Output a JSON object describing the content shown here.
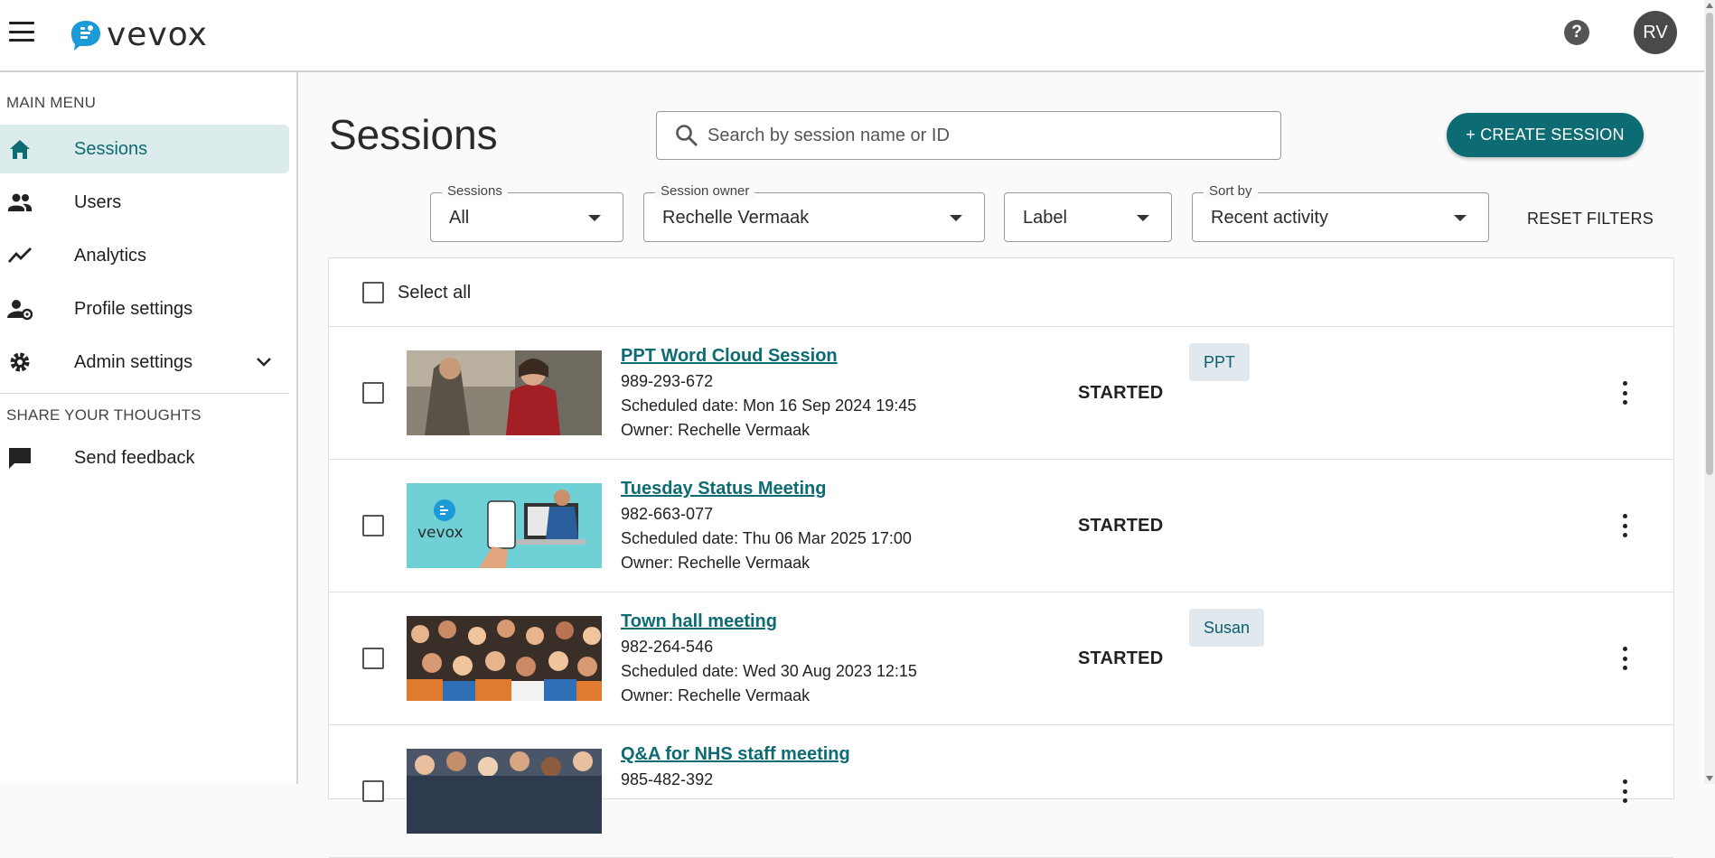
{
  "app": {
    "logo_text": "vevox",
    "avatar_initials": "RV",
    "help_glyph": "?"
  },
  "sidebar": {
    "main_menu_label": "MAIN MENU",
    "items": [
      {
        "label": "Sessions",
        "icon": "home-icon",
        "active": true
      },
      {
        "label": "Users",
        "icon": "users-icon"
      },
      {
        "label": "Analytics",
        "icon": "analytics-icon"
      },
      {
        "label": "Profile settings",
        "icon": "profile-settings-icon"
      },
      {
        "label": "Admin settings",
        "icon": "gear-icon",
        "expandable": true
      }
    ],
    "share_label": "SHARE YOUR THOUGHTS",
    "feedback_label": "Send feedback"
  },
  "main": {
    "title": "Sessions",
    "search_placeholder": "Search by session name or ID",
    "create_label": "+ CREATE SESSION",
    "filters": {
      "sessions": {
        "legend": "Sessions",
        "value": "All"
      },
      "owner": {
        "legend": "Session owner",
        "value": "Rechelle Vermaak"
      },
      "label": {
        "value": "Label"
      },
      "sort": {
        "legend": "Sort by",
        "value": "Recent activity"
      },
      "reset_label": "RESET FILTERS"
    },
    "select_all_label": "Select all",
    "sessions": [
      {
        "title": "PPT Word Cloud Session",
        "id": "989-293-672",
        "scheduled": "Scheduled date: Mon 16 Sep 2024 19:45",
        "owner": "Owner: Rechelle Vermaak",
        "status": "STARTED",
        "tag": "PPT"
      },
      {
        "title": "Tuesday Status Meeting",
        "id": "982-663-077",
        "scheduled": "Scheduled date: Thu 06 Mar 2025 17:00",
        "owner": "Owner: Rechelle Vermaak",
        "status": "STARTED",
        "tag": ""
      },
      {
        "title": "Town hall meeting",
        "id": "982-264-546",
        "scheduled": "Scheduled date: Wed 30 Aug 2023 12:15",
        "owner": "Owner: Rechelle Vermaak",
        "status": "STARTED",
        "tag": "Susan"
      },
      {
        "title": "Q&A for NHS staff meeting",
        "id": "985-482-392"
      }
    ]
  },
  "colors": {
    "accent": "#0c6b73",
    "active_bg": "#dcecec",
    "tag_bg": "#e1e8ee"
  }
}
